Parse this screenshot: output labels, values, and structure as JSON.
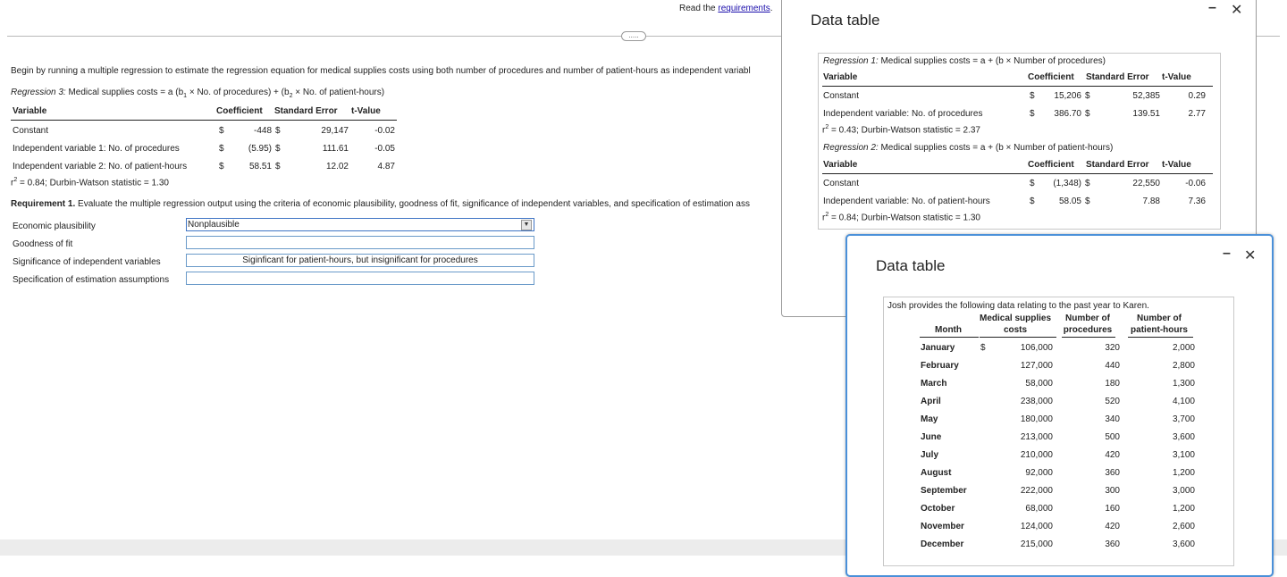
{
  "header": {
    "read_prefix": "Read the ",
    "requirements_link": "requirements",
    "read_suffix": ".",
    "expand": "....."
  },
  "intro": "Begin by running a multiple regression to estimate the regression equation for medical supplies costs using both number of procedures and number of patient-hours as independent variabl",
  "regression3": {
    "label": "Regression 3:",
    "equation_a": " Medical supplies costs = a (b",
    "sub1": "1",
    "equation_b": " × No. of procedures) + (b",
    "sub2": "2",
    "equation_c": " × No. of patient-hours)",
    "headers": {
      "variable": "Variable",
      "coefficient": "Coefficient",
      "stderr": "Standard Error",
      "tvalue": "t-Value"
    },
    "rows": [
      {
        "variable": "Constant",
        "cur": "$",
        "coef": "-448",
        "cur2": "$",
        "se": "29,147",
        "t": "-0.02"
      },
      {
        "variable": "Independent variable 1: No. of procedures",
        "cur": "$",
        "coef": "(5.95)",
        "cur2": "$",
        "se": "111.61",
        "t": "-0.05"
      },
      {
        "variable": "Independent variable 2: No. of patient-hours",
        "cur": "$",
        "coef": "58.51",
        "cur2": "$",
        "se": "12.02",
        "t": "4.87"
      }
    ],
    "r2_a": "r",
    "r2_b": "2",
    "r2_c": " = 0.84; Durbin-Watson statistic = 1.30"
  },
  "requirement": {
    "label": "Requirement 1.",
    "text": " Evaluate the multiple regression output using the criteria of economic plausibility, goodness of fit, significance of independent variables, and specification of estimation ass"
  },
  "criteria": [
    {
      "label": "Economic plausibility",
      "value": "Nonplausible"
    },
    {
      "label": "Goodness of fit",
      "value": ""
    },
    {
      "label": "Significance of independent variables",
      "value": "Siginficant for patient-hours, but insignificant for procedures"
    },
    {
      "label": "Specification of estimation assumptions",
      "value": ""
    }
  ],
  "data_table_1": {
    "title": "Data table",
    "minimize": "–",
    "close": "✕",
    "reg1": {
      "label": "Regression 1:",
      "equation": " Medical supplies costs = a + (b × Number of procedures)",
      "headers": {
        "variable": "Variable",
        "coefficient": "Coefficient",
        "stderr": "Standard Error",
        "tvalue": "t-Value"
      },
      "rows": [
        {
          "variable": "Constant",
          "cur": "$",
          "coef": "15,206",
          "cur2": "$",
          "se": "52,385",
          "t": "0.29"
        },
        {
          "variable": "Independent variable: No. of procedures",
          "cur": "$",
          "coef": "386.70",
          "cur2": "$",
          "se": "139.51",
          "t": "2.77"
        }
      ],
      "r2_a": "r",
      "r2_b": "2",
      "r2_c": " = 0.43; Durbin-Watson statistic = 2.37"
    },
    "reg2": {
      "label": "Regression 2:",
      "equation": " Medical supplies costs = a + (b × Number of patient-hours)",
      "headers": {
        "variable": "Variable",
        "coefficient": "Coefficient",
        "stderr": "Standard Error",
        "tvalue": "t-Value"
      },
      "rows": [
        {
          "variable": "Constant",
          "cur": "$",
          "coef": "(1,348)",
          "cur2": "$",
          "se": "22,550",
          "t": "-0.06"
        },
        {
          "variable": "Independent variable: No. of patient-hours",
          "cur": "$",
          "coef": "58.05",
          "cur2": "$",
          "se": "7.88",
          "t": "7.36"
        }
      ],
      "r2_a": "r",
      "r2_b": "2",
      "r2_c": " = 0.84; Durbin-Watson statistic = 1.30"
    }
  },
  "data_table_2": {
    "title": "Data table",
    "minimize": "–",
    "close": "✕",
    "intro": "Josh provides the following data relating to the past year to Karen.",
    "headers": {
      "month": "Month",
      "costs_1": "Medical supplies",
      "costs_2": "costs",
      "proc_1": "Number of",
      "proc_2": "procedures",
      "hours_1": "Number of",
      "hours_2": "patient-hours"
    },
    "currency": "$",
    "rows": [
      {
        "month": "January",
        "costs": "106,000",
        "procedures": "320",
        "hours": "2,000"
      },
      {
        "month": "February",
        "costs": "127,000",
        "procedures": "440",
        "hours": "2,800"
      },
      {
        "month": "March",
        "costs": "58,000",
        "procedures": "180",
        "hours": "1,300"
      },
      {
        "month": "April",
        "costs": "238,000",
        "procedures": "520",
        "hours": "4,100"
      },
      {
        "month": "May",
        "costs": "180,000",
        "procedures": "340",
        "hours": "3,700"
      },
      {
        "month": "June",
        "costs": "213,000",
        "procedures": "500",
        "hours": "3,600"
      },
      {
        "month": "July",
        "costs": "210,000",
        "procedures": "420",
        "hours": "3,100"
      },
      {
        "month": "August",
        "costs": "92,000",
        "procedures": "360",
        "hours": "1,200"
      },
      {
        "month": "September",
        "costs": "222,000",
        "procedures": "300",
        "hours": "3,000"
      },
      {
        "month": "October",
        "costs": "68,000",
        "procedures": "160",
        "hours": "1,200"
      },
      {
        "month": "November",
        "costs": "124,000",
        "procedures": "420",
        "hours": "2,600"
      },
      {
        "month": "December",
        "costs": "215,000",
        "procedures": "360",
        "hours": "3,600"
      }
    ]
  }
}
